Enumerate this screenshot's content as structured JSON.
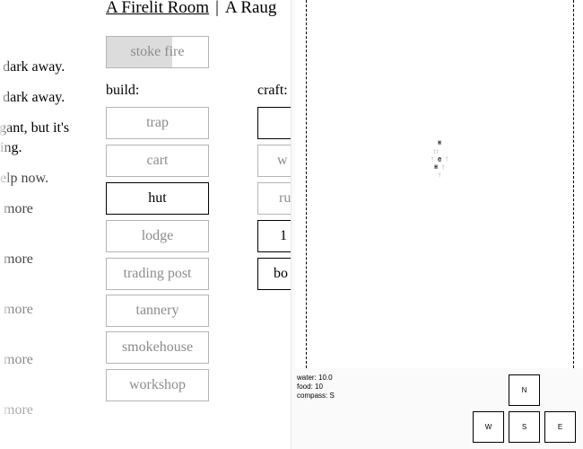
{
  "header": {
    "location": "A Firelit Room",
    "separator": "|",
    "next_location": "A Raug"
  },
  "log": [
    "e dark away.",
    "e dark away.",
    "egant, but it's",
    "bing.",
    "help now.",
    "h more",
    "h more",
    "h more",
    "h more",
    "h more"
  ],
  "stoke": {
    "label": "stoke fire",
    "cooldown_progress": 0.65
  },
  "build": {
    "title": "build:",
    "items": [
      {
        "label": "trap",
        "active": false
      },
      {
        "label": "cart",
        "active": false
      },
      {
        "label": "hut",
        "active": true
      },
      {
        "label": "lodge",
        "active": false
      },
      {
        "label": "trading post",
        "active": false
      },
      {
        "label": "tannery",
        "active": false
      },
      {
        "label": "smokehouse",
        "active": false
      },
      {
        "label": "workshop",
        "active": false
      }
    ]
  },
  "craft": {
    "title": "craft:",
    "items": [
      {
        "label": "",
        "active": true
      },
      {
        "label": "w",
        "active": false
      },
      {
        "label": "ru",
        "active": false
      },
      {
        "label": "1",
        "active": true
      },
      {
        "label": "bo",
        "active": true
      }
    ]
  },
  "map": {
    "home_marker": "@",
    "hut_marker": "H"
  },
  "stats": {
    "water": "water: 10.0",
    "food": "food: 10",
    "compass": "compass: S"
  },
  "controls": {
    "north": "N",
    "west": "W",
    "south": "S",
    "east": "E"
  }
}
